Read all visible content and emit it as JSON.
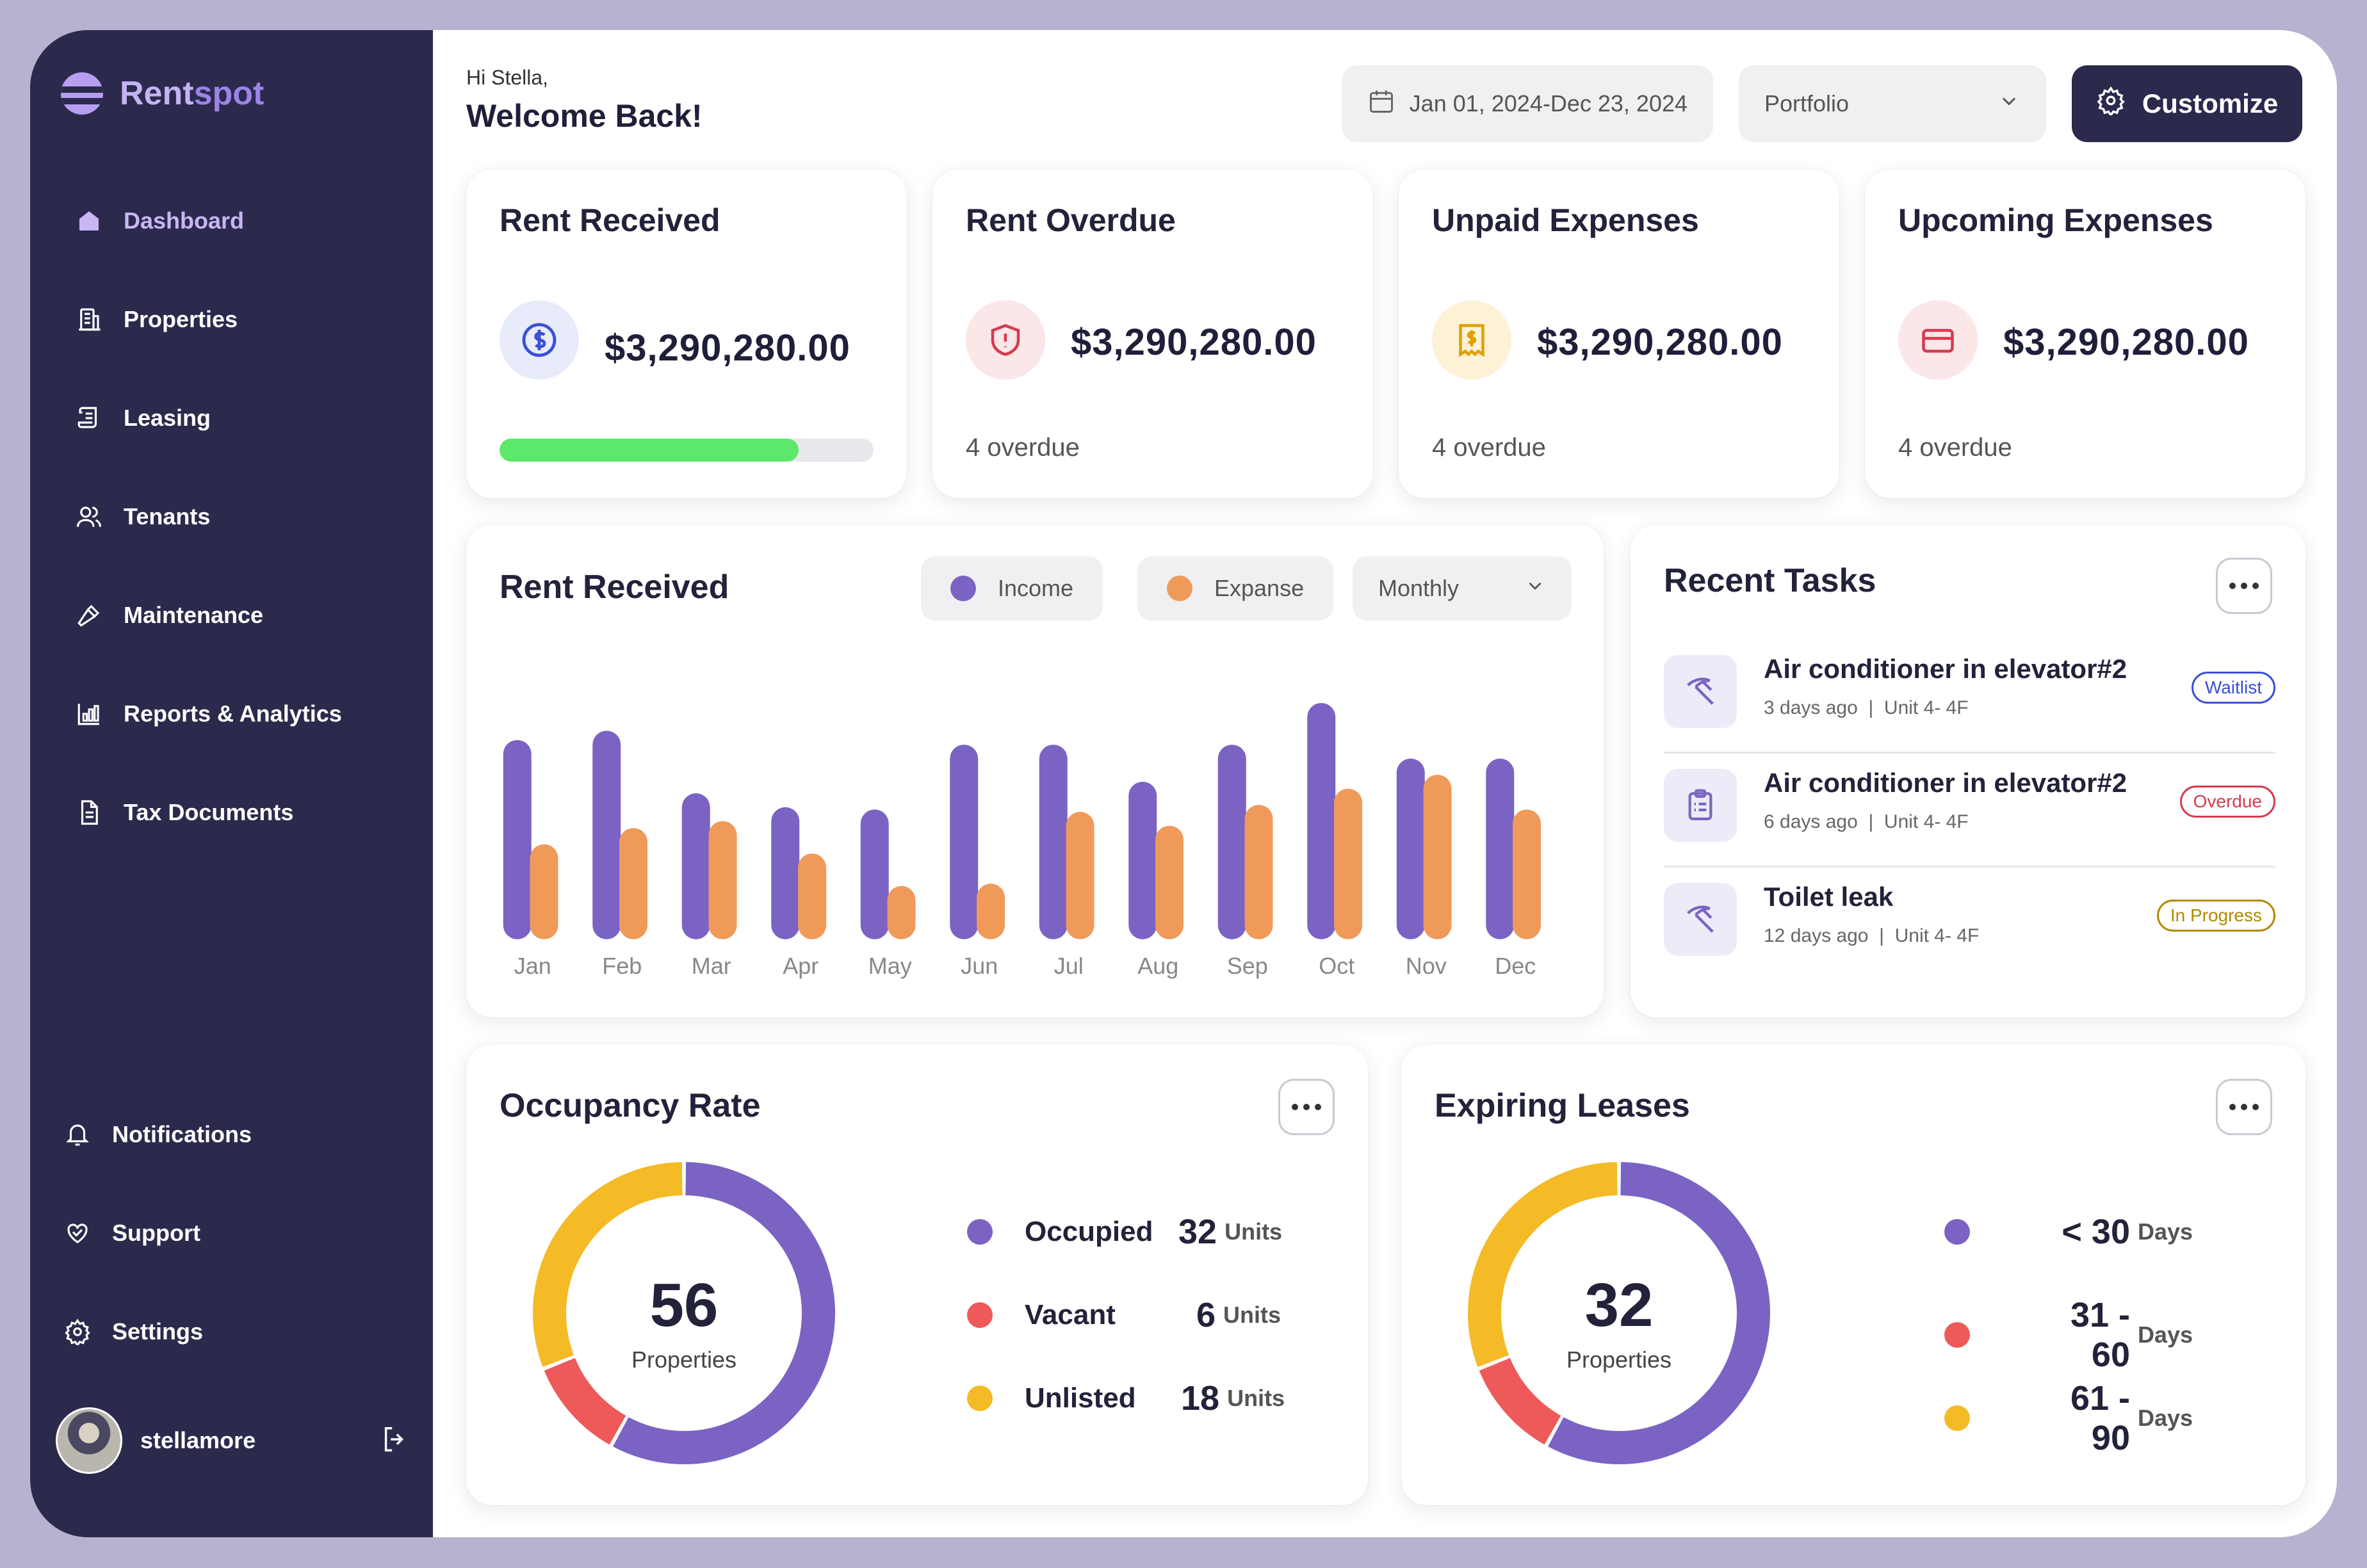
{
  "app": {
    "name_part1": "Rent",
    "name_part2": "spot"
  },
  "sidebar": {
    "items": [
      {
        "label": "Dashboard",
        "icon": "home-icon",
        "active": true
      },
      {
        "label": "Properties",
        "icon": "building-icon"
      },
      {
        "label": "Leasing",
        "icon": "scroll-icon"
      },
      {
        "label": "Tenants",
        "icon": "users-icon"
      },
      {
        "label": "Maintenance",
        "icon": "hammer-icon"
      },
      {
        "label": "Reports & Analytics",
        "icon": "chart-icon"
      },
      {
        "label": "Tax Documents",
        "icon": "document-icon"
      }
    ],
    "bottom": [
      {
        "label": "Notifications",
        "icon": "bell-icon"
      },
      {
        "label": "Support",
        "icon": "heart-hand-icon"
      },
      {
        "label": "Settings",
        "icon": "gear-icon"
      }
    ],
    "user": {
      "name": "stellamore"
    }
  },
  "header": {
    "greeting": "Hi Stella,",
    "welcome": "Welcome Back!",
    "date_range": "Jan 01, 2024-Dec 23, 2024",
    "portfolio": "Portfolio",
    "customize": "Customize"
  },
  "stats": [
    {
      "title": "Rent Received",
      "value": "$3,290,280.00",
      "progress": 0.8,
      "icon": "dollar-icon",
      "color": "#3a4fd6"
    },
    {
      "title": "Rent Overdue",
      "value": "$3,290,280.00",
      "sub": "4 overdue",
      "icon": "shield-alert-icon",
      "color": "#d63a4f"
    },
    {
      "title": "Unpaid Expenses",
      "value": "$3,290,280.00",
      "sub": "4 overdue",
      "icon": "receipt-icon",
      "color": "#e0a000"
    },
    {
      "title": "Upcoming Expenses",
      "value": "$3,290,280.00",
      "sub": "4 overdue",
      "icon": "card-icon",
      "color": "#d63a4f"
    }
  ],
  "rent_chart": {
    "title": "Rent Received",
    "legend_income": "Income",
    "legend_expense": "Expanse",
    "period": "Monthly"
  },
  "chart_data": {
    "type": "bar",
    "categories": [
      "Jan",
      "Feb",
      "Mar",
      "Apr",
      "May",
      "Jun",
      "Jul",
      "Aug",
      "Sep",
      "Oct",
      "Nov",
      "Dec"
    ],
    "series": [
      {
        "name": "Income",
        "color": "#7b63c4",
        "values": [
          86,
          90,
          63,
          57,
          56,
          84,
          84,
          68,
          84,
          102,
          78,
          78
        ]
      },
      {
        "name": "Expanse",
        "color": "#f09a5a",
        "values": [
          41,
          48,
          51,
          37,
          23,
          24,
          55,
          49,
          58,
          65,
          71,
          56
        ]
      }
    ],
    "ylim": [
      0,
      110
    ]
  },
  "tasks": {
    "title": "Recent Tasks",
    "items": [
      {
        "title": "Air conditioner in elevator#2",
        "time": "3 days ago",
        "unit": "Unit 4- 4F",
        "status": "Waitlist",
        "status_color": "#3a4fd6",
        "icon": "pickaxe-icon"
      },
      {
        "title": "Air conditioner in elevator#2",
        "time": "6 days ago",
        "unit": "Unit 4- 4F",
        "status": "Overdue",
        "status_color": "#d63a4f",
        "icon": "clipboard-icon"
      },
      {
        "title": "Toilet leak",
        "time": "12 days ago",
        "unit": "Unit 4- 4F",
        "status": "In Progress",
        "status_color": "#b08a00",
        "icon": "pickaxe-icon"
      }
    ]
  },
  "occupancy": {
    "title": "Occupancy Rate",
    "total": "56",
    "total_label": "Properties",
    "segments": [
      {
        "label": "Occupied",
        "value": "32",
        "unit": "Units",
        "color": "#7b63c4",
        "share": 0.58
      },
      {
        "label": "Vacant",
        "value": "6",
        "unit": "Units",
        "color": "#ee5a5a",
        "share": 0.11
      },
      {
        "label": "Unlisted",
        "value": "18",
        "unit": "Units",
        "color": "#f4bb27",
        "share": 0.31
      }
    ]
  },
  "leases": {
    "title": "Expiring Leases",
    "total": "32",
    "total_label": "Properties",
    "segments": [
      {
        "label": "< 30",
        "unit": "Days",
        "color": "#7b63c4",
        "share": 0.58
      },
      {
        "label": "31 - 60",
        "unit": "Days",
        "color": "#ee5a5a",
        "share": 0.11
      },
      {
        "label": "61 - 90",
        "unit": "Days",
        "color": "#f4bb27",
        "share": 0.31
      }
    ]
  }
}
